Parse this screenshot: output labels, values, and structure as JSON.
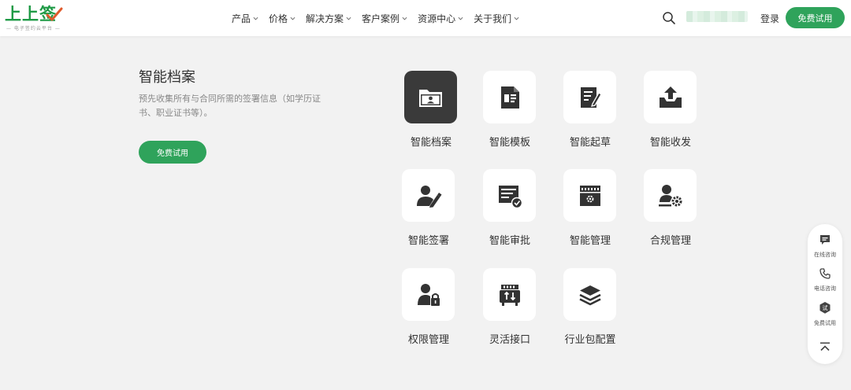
{
  "header": {
    "logo": {
      "title": "上上签",
      "subtitle": "— 电子签约云平台 —"
    },
    "nav": [
      "产品",
      "价格",
      "解决方案",
      "客户案例",
      "资源中心",
      "关于我们"
    ],
    "login": "登录",
    "trial": "免费试用"
  },
  "feature": {
    "title": "智能档案",
    "description": "预先收集所有与合同所需的签署信息（如学历证书、职业证书等）。",
    "trial": "免费试用"
  },
  "tiles": [
    {
      "label": "智能档案",
      "icon": "folder-user-icon",
      "active": true
    },
    {
      "label": "智能模板",
      "icon": "template-doc-icon",
      "active": false
    },
    {
      "label": "智能起草",
      "icon": "draft-edit-icon",
      "active": false
    },
    {
      "label": "智能收发",
      "icon": "send-receive-icon",
      "active": false
    },
    {
      "label": "智能签署",
      "icon": "user-sign-icon",
      "active": false
    },
    {
      "label": "智能审批",
      "icon": "approval-icon",
      "active": false
    },
    {
      "label": "智能管理",
      "icon": "manage-calendar-icon",
      "active": false
    },
    {
      "label": "合规管理",
      "icon": "compliance-user-gear-icon",
      "active": false
    },
    {
      "label": "权限管理",
      "icon": "permission-lock-icon",
      "active": false
    },
    {
      "label": "灵活接口",
      "icon": "interface-port-icon",
      "active": false
    },
    {
      "label": "行业包配置",
      "icon": "layers-icon",
      "active": false
    }
  ],
  "float": {
    "chat": "在线咨询",
    "phone": "电话咨询",
    "trial": "免费试用",
    "trial_badge": "试"
  },
  "colors": {
    "brand": "#2fa35b",
    "logo": "#1f9a46",
    "active_tile": "#3a3a3a",
    "icon": "#333333"
  }
}
